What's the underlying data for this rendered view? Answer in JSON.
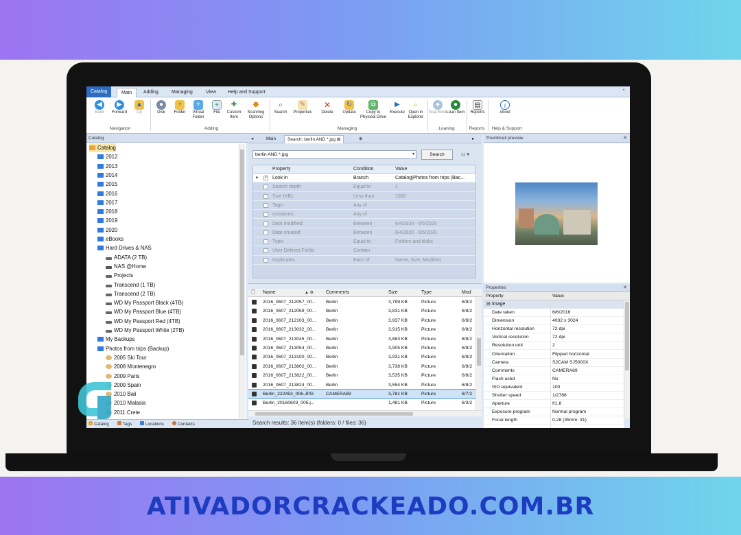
{
  "site": {
    "url": "ATIVADORCRACKEADO.COM.BR"
  },
  "colors": {
    "band_start": "#9d74f2",
    "band_end": "#6fd5ec",
    "url_text": "#1d3cc0",
    "selection": "#cde3f7",
    "catalog_tab": "#2d6cc3"
  },
  "ribbon_tabs": [
    "Catalog",
    "Main",
    "Adding",
    "Managing",
    "View",
    "Help and Support"
  ],
  "ribbon": {
    "buttons": [
      {
        "label": "Back",
        "icon": "back-arrow-icon",
        "disabled": true
      },
      {
        "label": "Forward",
        "icon": "forward-arrow-icon",
        "disabled": false
      },
      {
        "label": "Up",
        "icon": "folder-up-icon",
        "disabled": true
      },
      {
        "label": "Disk",
        "icon": "disk-icon",
        "disabled": false
      },
      {
        "label": "Folder",
        "icon": "folder-icon",
        "disabled": false
      },
      {
        "label": "Virtual Folder",
        "icon": "virtual-folder-icon",
        "disabled": false
      },
      {
        "label": "File",
        "icon": "file-icon",
        "disabled": false
      },
      {
        "label": "Custom Item",
        "icon": "custom-item-icon",
        "disabled": false
      },
      {
        "label": "Scanning Options",
        "icon": "gear-icon",
        "disabled": false
      },
      {
        "label": "Search",
        "icon": "search-icon",
        "disabled": false
      },
      {
        "label": "Properties",
        "icon": "properties-icon",
        "disabled": false
      },
      {
        "label": "Delete",
        "icon": "delete-icon",
        "disabled": false
      },
      {
        "label": "Update",
        "icon": "update-icon",
        "disabled": false
      },
      {
        "label": "Copy to Physical Drive",
        "icon": "copy-icon",
        "disabled": false
      },
      {
        "label": "Execute",
        "icon": "execute-icon",
        "disabled": false
      },
      {
        "label": "Open in Explorer",
        "icon": "open-explorer-icon",
        "disabled": false
      },
      {
        "label": "Total Book",
        "icon": "book-icon",
        "disabled": true
      },
      {
        "label": "Loan Item",
        "icon": "loan-icon",
        "disabled": false
      },
      {
        "label": "Reports",
        "icon": "reports-icon",
        "disabled": false
      },
      {
        "label": "About",
        "icon": "info-icon",
        "disabled": false
      }
    ],
    "groups": [
      "Navigation",
      "Adding",
      "Managing",
      "Loaning",
      "Reports",
      "Help & Support"
    ]
  },
  "catalog_panel": {
    "title": "Catalog",
    "tree": [
      {
        "label": "Catalog",
        "level": 0,
        "icon": "catalog-icon",
        "selected": true
      },
      {
        "label": "2012",
        "level": 1,
        "icon": "folder-icon"
      },
      {
        "label": "2013",
        "level": 1,
        "icon": "folder-icon"
      },
      {
        "label": "2014",
        "level": 1,
        "icon": "folder-icon"
      },
      {
        "label": "2015",
        "level": 1,
        "icon": "folder-icon"
      },
      {
        "label": "2016",
        "level": 1,
        "icon": "folder-icon"
      },
      {
        "label": "2017",
        "level": 1,
        "icon": "folder-icon"
      },
      {
        "label": "2018",
        "level": 1,
        "icon": "folder-icon"
      },
      {
        "label": "2019",
        "level": 1,
        "icon": "folder-icon"
      },
      {
        "label": "2020",
        "level": 1,
        "icon": "folder-icon"
      },
      {
        "label": "eBooks",
        "level": 1,
        "icon": "folder-icon"
      },
      {
        "label": "Hard Drives & NAS",
        "level": 1,
        "icon": "folder-icon"
      },
      {
        "label": "ADATA (2 TB)",
        "level": 2,
        "icon": "drive-icon"
      },
      {
        "label": "NAS @Home",
        "level": 2,
        "icon": "nas-icon"
      },
      {
        "label": "Projects",
        "level": 2,
        "icon": "drive-icon"
      },
      {
        "label": "Transcend (1 TB)",
        "level": 2,
        "icon": "drive-icon"
      },
      {
        "label": "Transcend (2 TB)",
        "level": 2,
        "icon": "drive-icon"
      },
      {
        "label": "WD My Passport Black (4TB)",
        "level": 2,
        "icon": "drive-icon"
      },
      {
        "label": "WD My Passport Blue (4TB)",
        "level": 2,
        "icon": "drive-icon"
      },
      {
        "label": "WD My Passport Red (4TB)",
        "level": 2,
        "icon": "drive-icon"
      },
      {
        "label": "WD My Passport White (2TB)",
        "level": 2,
        "icon": "drive-icon"
      },
      {
        "label": "My Backups",
        "level": 1,
        "icon": "folder-icon"
      },
      {
        "label": "Photos from trips (Backup)",
        "level": 1,
        "icon": "folder-icon"
      },
      {
        "label": "2005 Ski Tour",
        "level": 2,
        "icon": "disc-icon"
      },
      {
        "label": "2008 Montenegro",
        "level": 2,
        "icon": "disc-icon"
      },
      {
        "label": "2009 Paris",
        "level": 2,
        "icon": "disc-icon"
      },
      {
        "label": "2009 Spain",
        "level": 2,
        "icon": "disc-icon"
      },
      {
        "label": "2010 Bali",
        "level": 2,
        "icon": "disc-icon"
      },
      {
        "label": "2010 Malasia",
        "level": 2,
        "icon": "disc-icon"
      },
      {
        "label": "2011 Crete",
        "level": 2,
        "icon": "disc-icon"
      }
    ],
    "bottom_tabs": [
      "Catalog",
      "Tags",
      "Locations",
      "Contacts"
    ]
  },
  "doc_tabs": [
    "Main",
    "Search: berlin AND *.jpg"
  ],
  "search": {
    "query": "berlin AND *.jpg",
    "button": "Search",
    "columns": [
      "Property",
      "Condition",
      "Value"
    ],
    "conditions": [
      {
        "property": "Look in",
        "condition": "Branch",
        "value": "Catalog|Photos from trips (Bac...",
        "checked": true
      },
      {
        "property": "Search depth",
        "condition": "Equal to",
        "value": "1",
        "checked": false
      },
      {
        "property": "Size (KB):",
        "condition": "Less than",
        "value": "1000",
        "checked": false
      },
      {
        "property": "Tags:",
        "condition": "Any of",
        "value": "",
        "checked": false
      },
      {
        "property": "Locations:",
        "condition": "Any of",
        "value": "",
        "checked": false
      },
      {
        "property": "Date modified:",
        "condition": "Between",
        "value": "6/4/2020 - 6/5/2020",
        "checked": false
      },
      {
        "property": "Date created:",
        "condition": "Between",
        "value": "6/4/2020 - 6/5/2020",
        "checked": false
      },
      {
        "property": "Type:",
        "condition": "Equal to",
        "value": "Folders and disks",
        "checked": false
      },
      {
        "property": "User Defined Fields",
        "condition": "Contain",
        "value": "",
        "checked": false
      },
      {
        "property": "Duplicates",
        "condition": "Each of",
        "value": "Name, Size, Modified",
        "checked": false
      }
    ]
  },
  "results": {
    "columns": [
      "Name",
      "Comments",
      "Size",
      "Type",
      "Mod"
    ],
    "rows": [
      {
        "name": "2016_0607_212057_00...",
        "comments": "Berlin",
        "size": "3,799 KB",
        "type": "Picture",
        "mod": "6/8/2",
        "selected": false
      },
      {
        "name": "2016_0607_212059_00...",
        "comments": "Berlin",
        "size": "3,831 KB",
        "type": "Picture",
        "mod": "6/8/2",
        "selected": false
      },
      {
        "name": "2016_0607_212103_00...",
        "comments": "Berlin",
        "size": "3,937 KB",
        "type": "Picture",
        "mod": "6/8/2",
        "selected": false
      },
      {
        "name": "2016_0607_213032_00...",
        "comments": "Berlin",
        "size": "3,915 KB",
        "type": "Picture",
        "mod": "6/8/2",
        "selected": false
      },
      {
        "name": "2016_0607_213045_00...",
        "comments": "Berlin",
        "size": "3,883 KB",
        "type": "Picture",
        "mod": "6/8/2",
        "selected": false
      },
      {
        "name": "2016_0607_213054_00...",
        "comments": "Berlin",
        "size": "3,905 KB",
        "type": "Picture",
        "mod": "6/8/2",
        "selected": false
      },
      {
        "name": "2016_0607_213100_00...",
        "comments": "Berlin",
        "size": "3,931 KB",
        "type": "Picture",
        "mod": "6/8/2",
        "selected": false
      },
      {
        "name": "2016_0607_213802_00...",
        "comments": "Berlin",
        "size": "3,738 KB",
        "type": "Picture",
        "mod": "6/8/2",
        "selected": false
      },
      {
        "name": "2016_0607_213822_00...",
        "comments": "Berlin",
        "size": "3,535 KB",
        "type": "Picture",
        "mod": "6/8/2",
        "selected": false
      },
      {
        "name": "2016_0607_213824_00...",
        "comments": "Berlin",
        "size": "3,554 KB",
        "type": "Picture",
        "mod": "6/8/2",
        "selected": false
      },
      {
        "name": "Berlin_222453_006.JPG",
        "comments": "CAMERA69",
        "size": "3,781 KB",
        "type": "Picture",
        "mod": "6/7/2",
        "selected": true
      },
      {
        "name": "Berlin_20160603_005.j...",
        "comments": "",
        "size": "1,481 KB",
        "type": "Picture",
        "mod": "6/3/2",
        "selected": false
      }
    ],
    "status": "Search results: 36 item(s) (folders: 0 / files: 36)"
  },
  "thumbnail_panel": {
    "title": "Thumbnail preview"
  },
  "properties_panel": {
    "title": "Properties",
    "columns": [
      "Property",
      "Value"
    ],
    "category": "Image",
    "rows": [
      {
        "name": "Date taken",
        "value": "6/6/2016"
      },
      {
        "name": "Dimension",
        "value": "4032 x 3024"
      },
      {
        "name": "Horizontal resolution",
        "value": "72 dpi"
      },
      {
        "name": "Vertical resolution",
        "value": "72 dpi"
      },
      {
        "name": "Resolution unit",
        "value": "2"
      },
      {
        "name": "Orientation",
        "value": "Flipped horizontal"
      },
      {
        "name": "Camera",
        "value": "SJCAM SJ5000X"
      },
      {
        "name": "Comments",
        "value": "CAMERA69"
      },
      {
        "name": "Flash used",
        "value": "No"
      },
      {
        "name": "ISO equivalent",
        "value": "100"
      },
      {
        "name": "Shutter speed",
        "value": "1/2786"
      },
      {
        "name": "Aperture",
        "value": "f/1.8"
      },
      {
        "name": "Exposure program",
        "value": "Normal program"
      },
      {
        "name": "Focal length",
        "value": "0.28 (35mm: 31)"
      }
    ]
  }
}
